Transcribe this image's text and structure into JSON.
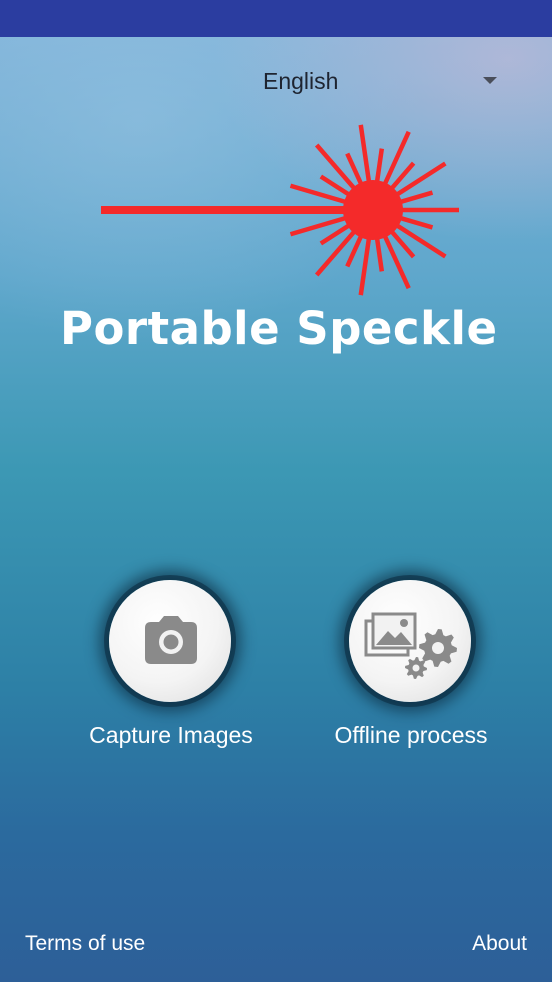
{
  "language_selector": {
    "selected": "English"
  },
  "logo": {
    "text": "Portable Speckle",
    "laser_color": "#f42a2a",
    "icon": "laser-burst-icon"
  },
  "actions": [
    {
      "label": "Capture Images",
      "icon": "camera-icon"
    },
    {
      "label": "Offline process",
      "icon": "images-gears-icon"
    }
  ],
  "footer": {
    "terms_label": "Terms of use",
    "about_label": "About"
  },
  "colors": {
    "status_bar": "#2b3da0",
    "button_icon": "#8a8a8a"
  }
}
